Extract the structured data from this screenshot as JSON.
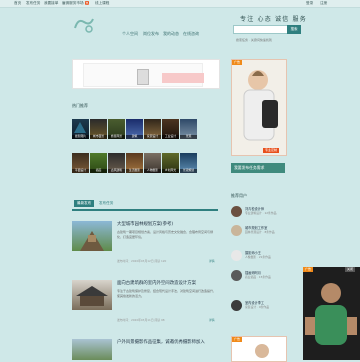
{
  "topbar": {
    "links": [
      "首页",
      "发布任务",
      "我要接单",
      "雇佣服务市场",
      "热门",
      "线上课程"
    ],
    "hot_badge": "热",
    "right_links": [
      "登录",
      "注册"
    ]
  },
  "header": {
    "logo_text": "前途",
    "nav": [
      "个人空间",
      "岗位发布",
      "我的动态",
      "在线咨询"
    ],
    "slogan": "专注 心态 诚信 服务",
    "search_placeholder": "搜索任务 · 关键词快速找到",
    "search_button": "搜索"
  },
  "main": {
    "section_title": "热门推荐",
    "thumbs_row1": [
      "摄影图片",
      "城市夜景",
      "旅游风景",
      "建筑",
      "家居设计",
      "工业设计",
      "景观"
    ],
    "thumbs_row2": [
      "平面设计",
      "插画",
      "古风建筑",
      "生活摄影",
      "人物摄影",
      "乡村风光",
      "景观规划"
    ],
    "tabs": [
      "最新发布",
      "发布任务"
    ],
    "articles": [
      {
        "title": "大型城市园林规划方案(参考)",
        "summary": "古建筑一期项目规划方案，设计风格与历史文化融合，合理布局空间与绿化，打造宜居环境。",
        "meta": "发布时间：2020年03月12日  阅读 120",
        "action": "详情"
      },
      {
        "title": "面向古建筑群的室内外空间改造设计方案",
        "summary": "专注于古建筑保护及修复，结合现代设计手法，对建筑空间进行改造提升，使其焕发新的活力。",
        "meta": "发布时间：2020年03月11日  阅读 98",
        "action": "详情"
      },
      {
        "title": "户外风景摄影作品征集，诚邀优秀摄影师加入",
        "summary": "",
        "meta": "",
        "action": ""
      }
    ]
  },
  "sidebar": {
    "ad_tag": "广告",
    "ad_caption": "专业定制",
    "ad_tag_bottom": "广告",
    "action_button": "我要发布任务需求",
    "recommend_title": "推荐用户",
    "recommends": [
      {
        "name": "刘青松设计师",
        "sub": "专业建筑设计 · 12条作品"
      },
      {
        "name": "城市规划工作室",
        "sub": "园林景观设计 · 8条作品"
      },
      {
        "name": "摄影师小王",
        "sub": "人像摄影 · 21条作品"
      },
      {
        "name": "插画师阿月",
        "sub": "商业插画 · 15条作品"
      },
      {
        "name": "室内设计李工",
        "sub": "家装设计 · 9条作品"
      }
    ]
  },
  "float_ad": {
    "tag": "广告",
    "close": "关闭"
  }
}
